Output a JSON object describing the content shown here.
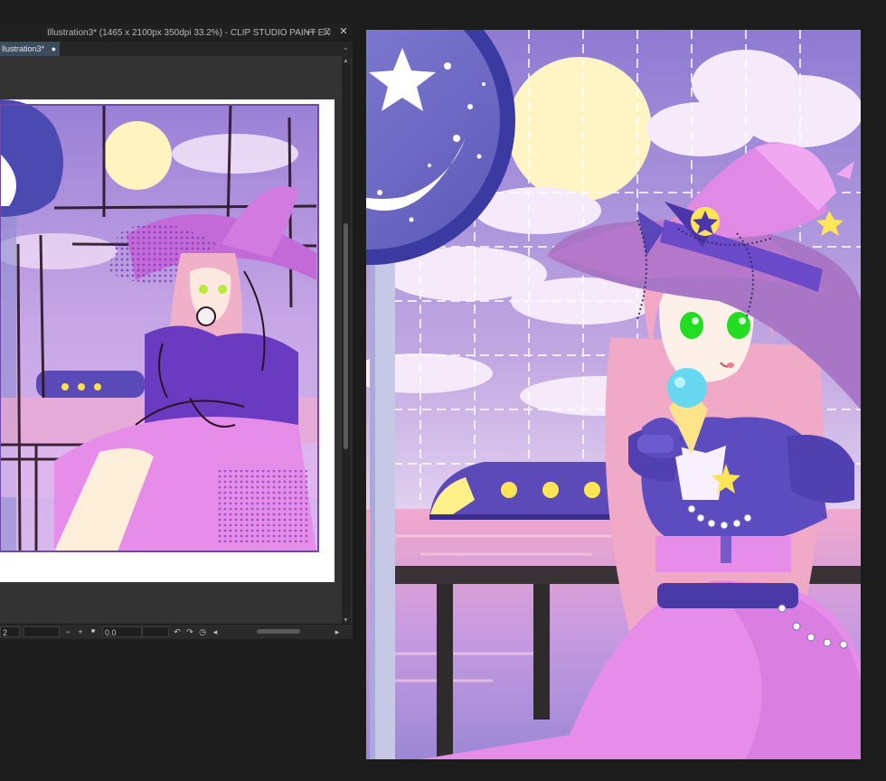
{
  "app": {
    "title": "Illustration3* (1465 x 2100px 350dpi 33.2%)  - CLIP STUDIO PAINT EX",
    "window_controls": [
      "—",
      "□",
      "✕"
    ]
  },
  "tab": {
    "label": "llustration3*",
    "modified_dot": "●",
    "dropdown": "⌄"
  },
  "status_bar": {
    "zoom_value": "2",
    "zoom_out": "−",
    "zoom_in": "+",
    "fit": "■",
    "angle_value": "0.0",
    "rotate_left": "↶",
    "rotate_right": "↷",
    "reset": "◷",
    "flip": "◂",
    "scroll_right": "▸"
  },
  "icons": {
    "minimize": "minimize-icon",
    "maximize": "maximize-icon",
    "close": "close-icon"
  },
  "colors": {
    "panel_bg": "#2b2b2b",
    "tab_active": "#3d4b5e",
    "sky_top": "#8f7bd0",
    "sky_bottom": "#e6d6f0",
    "moon": "#fff4c4",
    "sign_blue": "#3a3aa0",
    "dress": "#e58de9",
    "hat": "#d176d8",
    "jacket": "#5c4cc0",
    "hair": "#f0a8c0",
    "eyes": "#21e021",
    "ice_cream": "#66d8f0"
  }
}
